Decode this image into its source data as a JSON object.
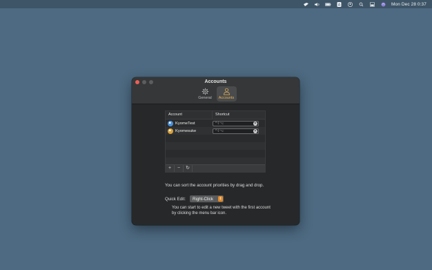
{
  "menubar": {
    "icons": [
      "bird-icon",
      "volume-icon",
      "battery-icon",
      "keyboard-input-icon",
      "user-icon",
      "search-icon",
      "display-icon",
      "siri-icon"
    ],
    "clock": "Mon Dec 28  0:37"
  },
  "window": {
    "title": "Accounts",
    "toolbar": [
      {
        "label": "General",
        "icon": "gear-icon",
        "active": false
      },
      {
        "label": "Accounts",
        "icon": "person-icon",
        "active": true
      }
    ]
  },
  "table": {
    "headers": {
      "account": "Account",
      "shortcut": "Shortcut"
    },
    "rows": [
      {
        "account": "KyomeTest",
        "shortcut_placeholder": "^⇧⌥",
        "avatar_color": "#4a8fd8"
      },
      {
        "account": "Kyomesuke",
        "shortcut_placeholder": "^⇧⌥",
        "avatar_color": "#d8a13a"
      }
    ],
    "footer_buttons": [
      "+",
      "−",
      "↻"
    ]
  },
  "hint_sort": "You can sort the account priorities by drag and drop.",
  "quick_edit": {
    "label": "Quick Edit:",
    "value": "Right-Click"
  },
  "hint_quick_edit": "You can start to edit a new tweet with the first account by clicking the menu bar icon.",
  "colors": {
    "accent": "#e8b35a",
    "desktop": "#4d6a82",
    "close": "#ec5f57"
  }
}
